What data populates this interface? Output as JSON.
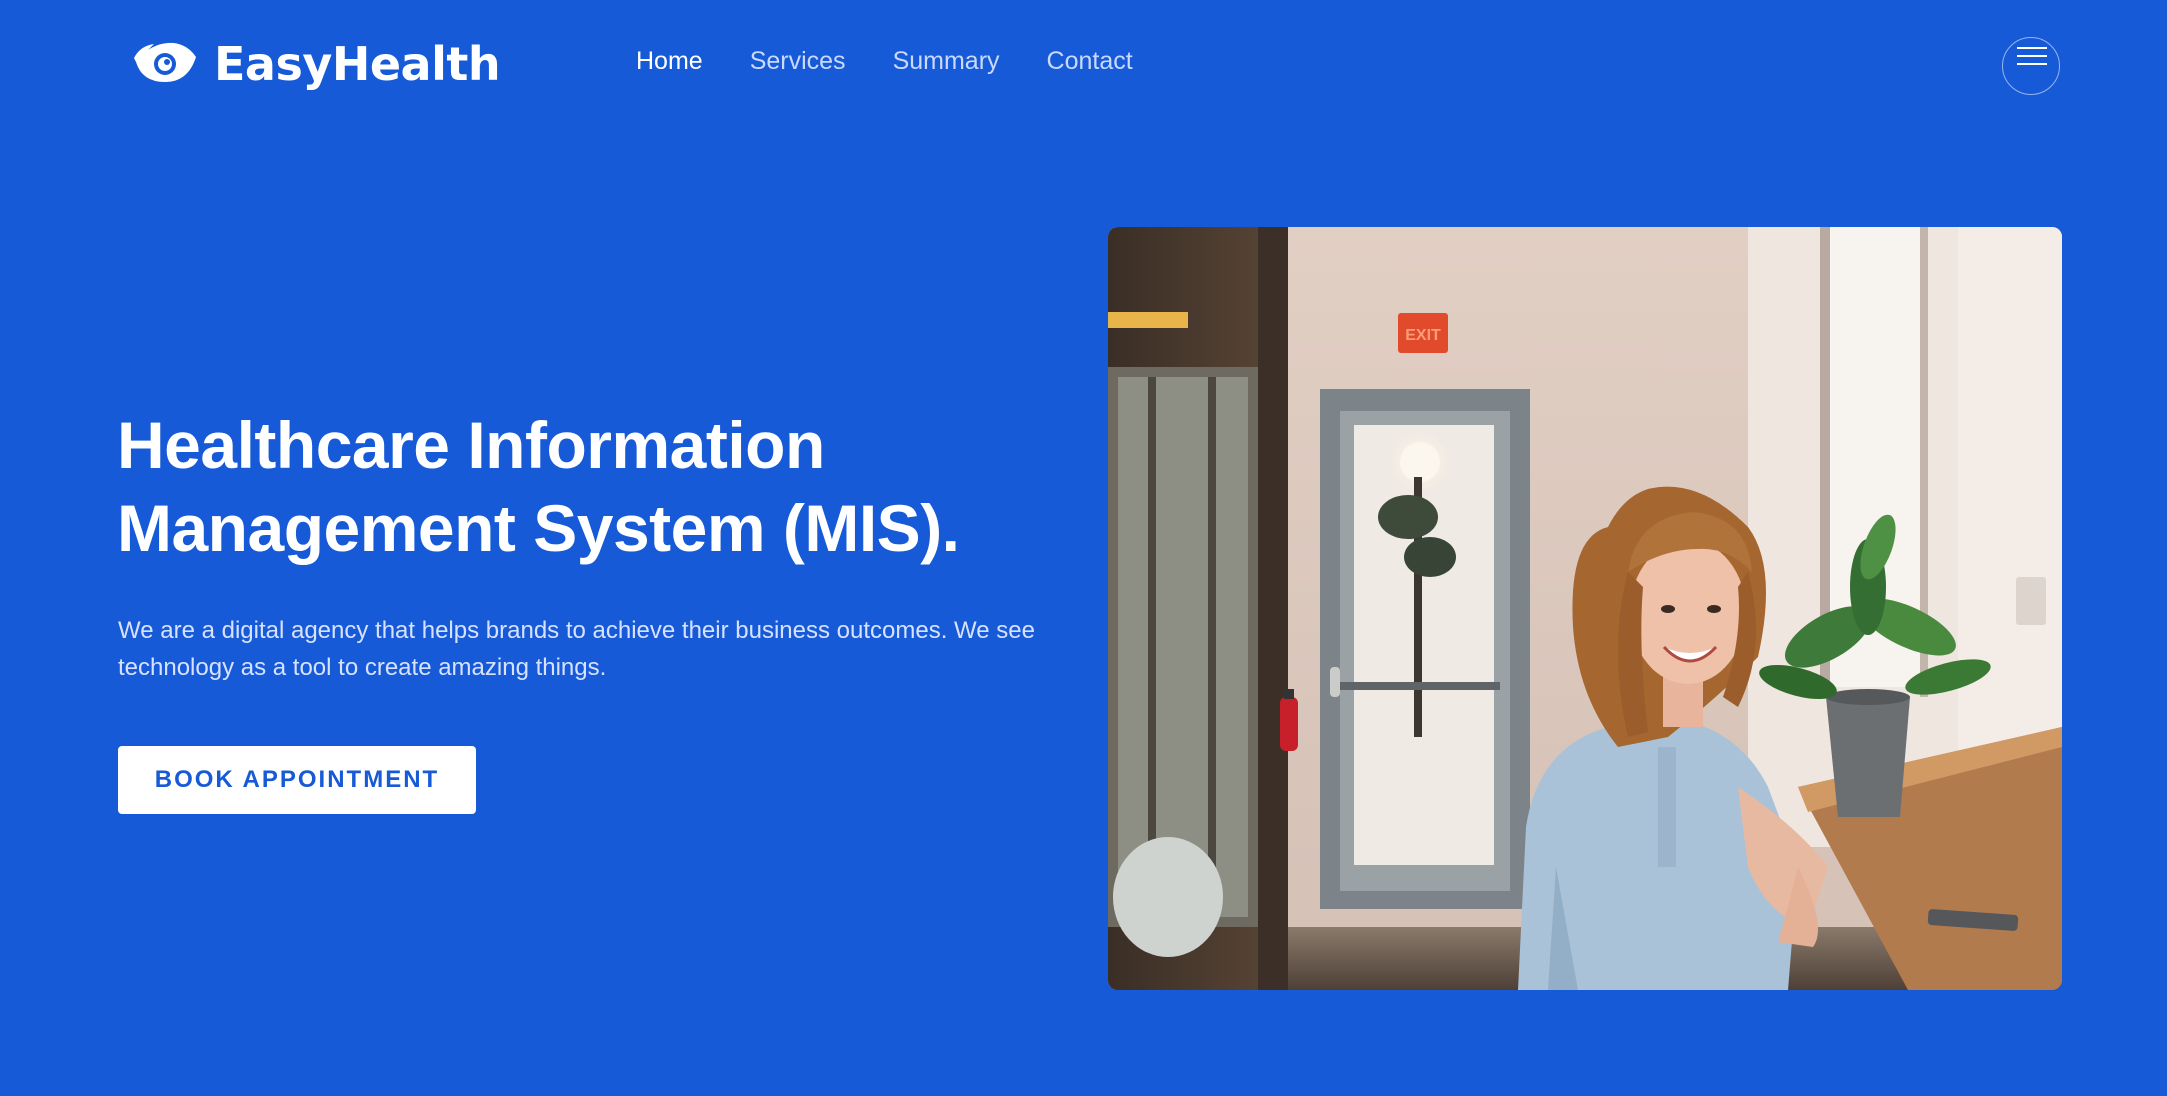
{
  "brand": {
    "name": "EasyHealth",
    "icon": "eye-icon"
  },
  "nav": {
    "items": [
      {
        "label": "Home",
        "active": true
      },
      {
        "label": "Services",
        "active": false
      },
      {
        "label": "Summary",
        "active": false
      },
      {
        "label": "Contact",
        "active": false
      }
    ]
  },
  "menu": {
    "icon": "hamburger-menu-icon"
  },
  "hero": {
    "title": "Healthcare Information Management System (MIS).",
    "subtitle": "We are a digital agency that helps brands to achieve their business outcomes. We see technology as a tool to create amazing things.",
    "cta_label": "BOOK APPOINTMENT"
  },
  "photo": {
    "exit_sign": "EXIT"
  },
  "colors": {
    "background": "#175ad8",
    "text": "#ffffff",
    "nav_inactive": "#c9d9ff",
    "subtitle": "#d6e2ff",
    "button_text": "#175ad8"
  }
}
